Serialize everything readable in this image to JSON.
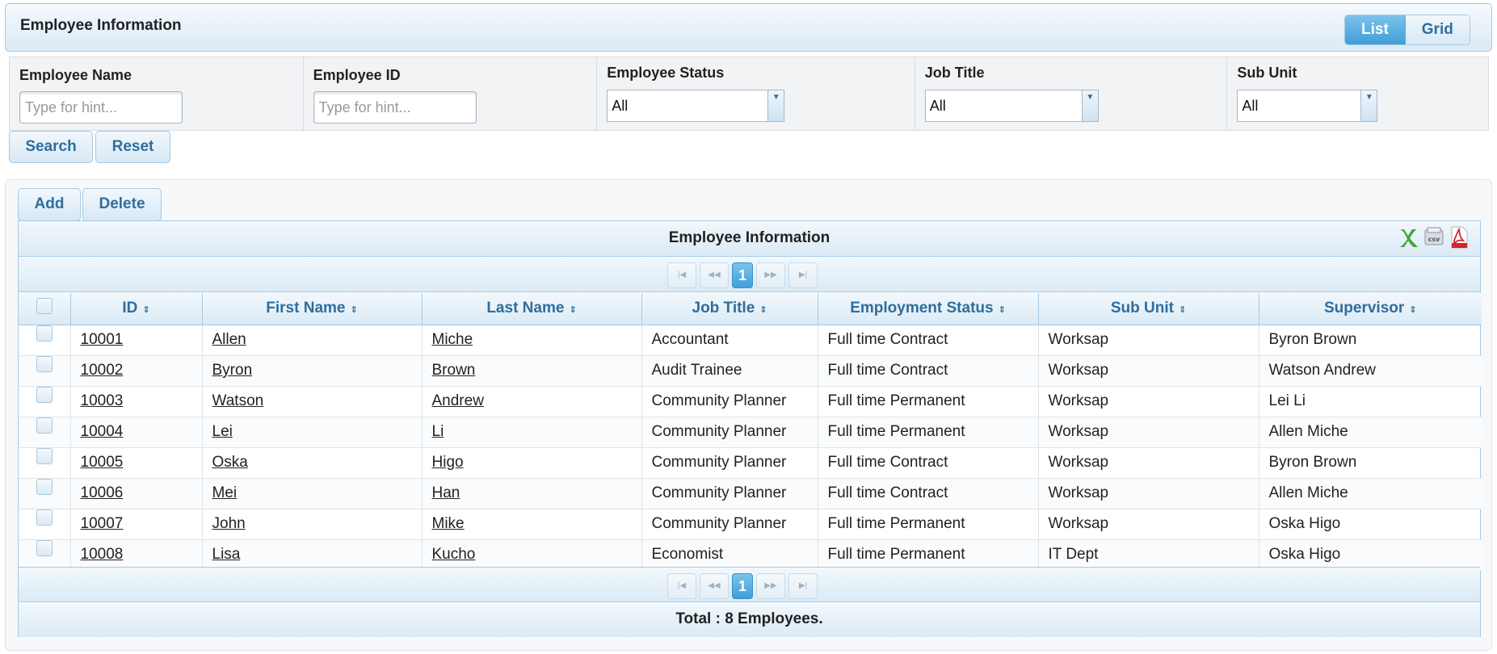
{
  "header": {
    "title": "Employee Information",
    "view_list": "List",
    "view_grid": "Grid"
  },
  "filters": {
    "employee_name": {
      "label": "Employee Name",
      "placeholder": "Type for hint..."
    },
    "employee_id": {
      "label": "Employee ID",
      "placeholder": "Type for hint..."
    },
    "employee_status": {
      "label": "Employee Status",
      "value": "All"
    },
    "job_title": {
      "label": "Job Title",
      "value": "All"
    },
    "sub_unit": {
      "label": "Sub Unit",
      "value": "All"
    },
    "search_label": "Search",
    "reset_label": "Reset"
  },
  "actions": {
    "add_label": "Add",
    "delete_label": "Delete"
  },
  "grid": {
    "caption": "Employee Information",
    "export_icons": [
      "excel-icon",
      "csv-icon",
      "pdf-icon"
    ],
    "current_page": "1",
    "columns": [
      "ID",
      "First Name",
      "Last Name",
      "Job Title",
      "Employment Status",
      "Sub Unit",
      "Supervisor"
    ],
    "rows": [
      [
        "10001",
        "Allen",
        "Miche",
        "Accountant",
        "Full time Contract",
        "Worksap",
        "Byron Brown"
      ],
      [
        "10002",
        "Byron",
        "Brown",
        "Audit Trainee",
        "Full time Contract",
        "Worksap",
        "Watson Andrew"
      ],
      [
        "10003",
        "Watson",
        "Andrew",
        "Community Planner",
        "Full time Permanent",
        "Worksap",
        "Lei Li"
      ],
      [
        "10004",
        "Lei",
        "Li",
        "Community Planner",
        "Full time Permanent",
        "Worksap",
        "Allen Miche"
      ],
      [
        "10005",
        "Oska",
        "Higo",
        "Community Planner",
        "Full time Contract",
        "Worksap",
        "Byron Brown"
      ],
      [
        "10006",
        "Mei",
        "Han",
        "Community Planner",
        "Full time Contract",
        "Worksap",
        "Allen Miche"
      ],
      [
        "10007",
        "John",
        "Mike",
        "Community Planner",
        "Full time Permanent",
        "Worksap",
        "Oska Higo"
      ],
      [
        "10008",
        "Lisa",
        "Kucho",
        "Economist",
        "Full time Permanent",
        "IT Dept",
        "Oska Higo"
      ]
    ],
    "total": "Total : 8 Employees."
  },
  "colors": {
    "accent": "#2e6e9e",
    "border": "#a6c9e2",
    "active": "#3f9fd8"
  }
}
